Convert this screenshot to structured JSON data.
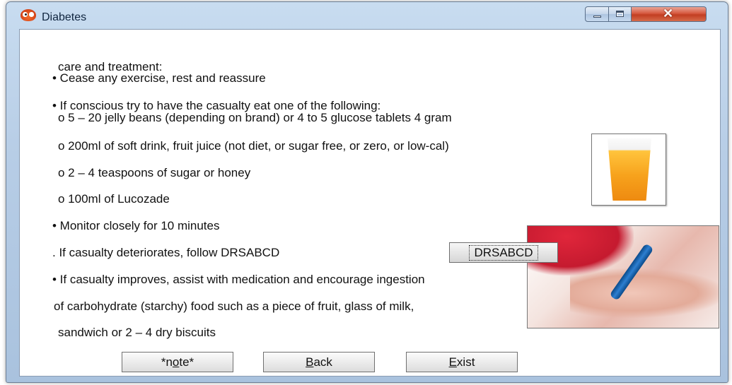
{
  "window": {
    "title": "Diabetes",
    "icon": "owl-app-icon",
    "controls": [
      "minimize-icon",
      "maximize-icon",
      "close-icon"
    ]
  },
  "content": {
    "lines": [
      "care and treatment:",
      "• Cease any exercise, rest and reassure",
      "• If conscious try to have the casualty eat one of the following:",
      "o 5 – 20 jelly beans (depending on brand) or 4 to 5 glucose tablets 4 gram",
      "o 200ml of soft drink, fruit juice (not diet, or sugar free, or zero, or low-cal)",
      "o 2 – 4 teaspoons of sugar or honey",
      "o 100ml of Lucozade",
      "• Monitor closely for 10 minutes",
      ". If casualty deteriorates, follow DRSABCD",
      "• If casualty improves, assist with medication and encourage ingestion",
      "of carbohydrate (starchy) food such as a piece of fruit, glass of milk,",
      "sandwich or 2 – 4 dry biscuits"
    ],
    "drsabcd_button": "DRSABCD"
  },
  "buttons": {
    "note": {
      "before": "*n",
      "mnemonic": "o",
      "after": "te*"
    },
    "back": {
      "mnemonic": "B",
      "after": "ack"
    },
    "exist": {
      "mnemonic": "E",
      "after": "xist"
    }
  },
  "images": {
    "juice": "glass-of-orange-juice",
    "hand": "glucose-test-hand"
  }
}
